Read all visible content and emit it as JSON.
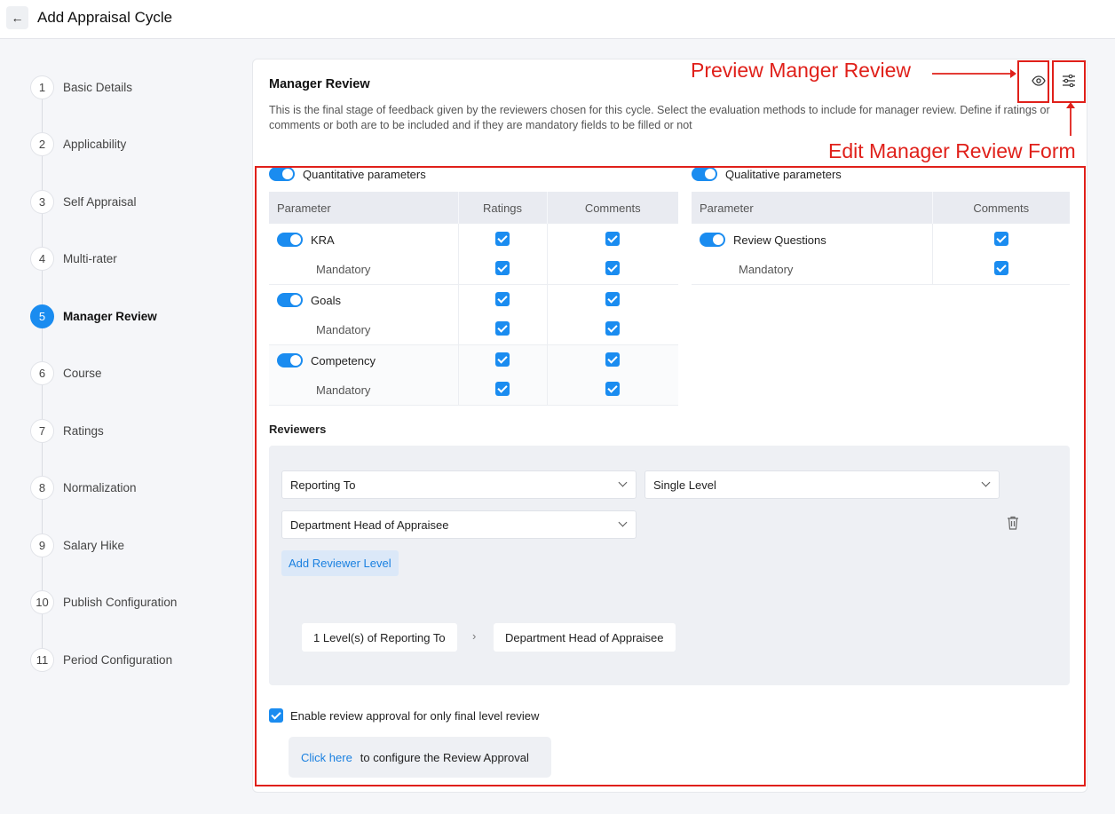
{
  "header": {
    "title": "Add Appraisal Cycle"
  },
  "steps": [
    {
      "num": "1",
      "label": "Basic Details"
    },
    {
      "num": "2",
      "label": "Applicability"
    },
    {
      "num": "3",
      "label": "Self Appraisal"
    },
    {
      "num": "4",
      "label": "Multi-rater"
    },
    {
      "num": "5",
      "label": "Manager Review",
      "active": true
    },
    {
      "num": "6",
      "label": "Course"
    },
    {
      "num": "7",
      "label": "Ratings"
    },
    {
      "num": "8",
      "label": "Normalization"
    },
    {
      "num": "9",
      "label": "Salary Hike"
    },
    {
      "num": "10",
      "label": "Publish Configuration"
    },
    {
      "num": "11",
      "label": "Period Configuration"
    }
  ],
  "card": {
    "title": "Manager Review",
    "description": "This is the final stage of feedback given by the reviewers chosen for this cycle. Select the evaluation methods to include for manager review. Define if ratings or comments or both are to be included and if they are mandatory fields to be filled or not"
  },
  "annotations": {
    "preview": "Preview Manger Review",
    "edit": "Edit Manager Review Form"
  },
  "quantitative": {
    "label": "Quantitative parameters",
    "headers": {
      "parameter": "Parameter",
      "ratings": "Ratings",
      "comments": "Comments"
    },
    "rows": [
      {
        "name": "KRA",
        "mandatory": "Mandatory"
      },
      {
        "name": "Goals",
        "mandatory": "Mandatory"
      },
      {
        "name": "Competency",
        "mandatory": "Mandatory"
      }
    ]
  },
  "qualitative": {
    "label": "Qualitative parameters",
    "headers": {
      "parameter": "Parameter",
      "comments": "Comments"
    },
    "rows": [
      {
        "name": "Review Questions",
        "mandatory": "Mandatory"
      }
    ]
  },
  "reviewers": {
    "title": "Reviewers",
    "reporting_to": "Reporting To",
    "level": "Single Level",
    "dept_head": "Department Head of Appraisee",
    "add_level": "Add Reviewer Level",
    "flow": [
      "1 Level(s) of Reporting To",
      "Department Head of Appraisee"
    ],
    "flow_arrow": "›"
  },
  "approval": {
    "label": "Enable review approval for only final level review",
    "link": "Click here",
    "link_suffix": "to configure the Review Approval"
  },
  "colors": {
    "accent": "#1a8cf0",
    "annotation": "#e0201a"
  }
}
